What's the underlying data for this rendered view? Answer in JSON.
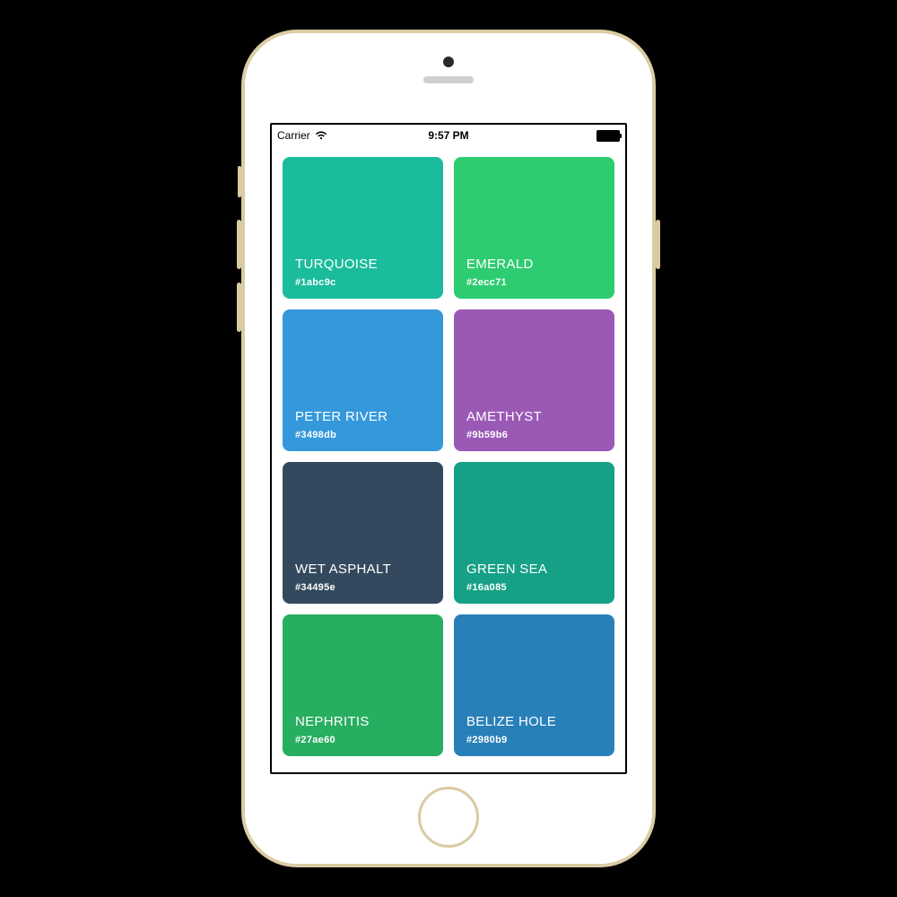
{
  "status": {
    "carrier": "Carrier",
    "time": "9:57 PM"
  },
  "palette": [
    {
      "name": "TURQUOISE",
      "hex": "#1abc9c"
    },
    {
      "name": "EMERALD",
      "hex": "#2ecc71"
    },
    {
      "name": "PETER RIVER",
      "hex": "#3498db"
    },
    {
      "name": "AMETHYST",
      "hex": "#9b59b6"
    },
    {
      "name": "WET ASPHALT",
      "hex": "#34495e"
    },
    {
      "name": "GREEN SEA",
      "hex": "#16a085"
    },
    {
      "name": "NEPHRITIS",
      "hex": "#27ae60"
    },
    {
      "name": "BELIZE HOLE",
      "hex": "#2980b9"
    }
  ]
}
